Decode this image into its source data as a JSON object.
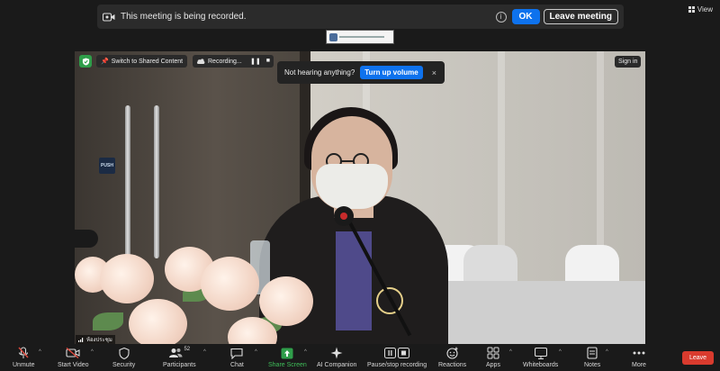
{
  "banner": {
    "recording_text": "This meeting is being recorded.",
    "ok_label": "OK",
    "leave_meeting_label": "Leave meeting"
  },
  "view": {
    "label": "View"
  },
  "video_overlay": {
    "switch_shared_label": "Switch to Shared Content",
    "recording_label": "Recording...",
    "not_hearing_text": "Not hearing anything?",
    "turn_up_label": "Turn up volume",
    "close_symbol": "×",
    "sign_in_label": "Sign in",
    "name_tag": "ห้องประชุม"
  },
  "toolbar": {
    "items": [
      {
        "label": "Unmute",
        "icon": "mic-muted-icon"
      },
      {
        "label": "Start Video",
        "icon": "video-off-icon"
      },
      {
        "label": "Security",
        "icon": "shield-icon"
      },
      {
        "label": "Participants",
        "icon": "participants-icon",
        "count": "52"
      },
      {
        "label": "Chat",
        "icon": "chat-icon"
      },
      {
        "label": "Share Screen",
        "icon": "share-screen-icon"
      },
      {
        "label": "AI Companion",
        "icon": "ai-companion-icon"
      },
      {
        "label": "Pause/stop recording",
        "icon": "pause-stop-icon"
      },
      {
        "label": "Reactions",
        "icon": "reactions-icon"
      },
      {
        "label": "Apps",
        "icon": "apps-icon"
      },
      {
        "label": "Whiteboards",
        "icon": "whiteboard-icon"
      },
      {
        "label": "Notes",
        "icon": "notes-icon"
      },
      {
        "label": "More",
        "icon": "more-icon"
      }
    ],
    "leave_label": "Leave"
  },
  "colors": {
    "accent": "#0e72ed",
    "leave": "#d93b2e",
    "share": "#2f9e4a"
  }
}
